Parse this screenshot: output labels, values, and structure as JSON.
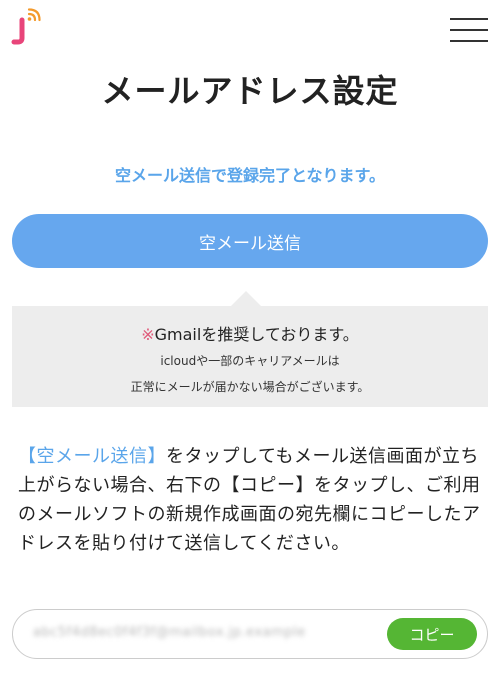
{
  "header": {
    "logo_alt": "J",
    "menu_icon": "hamburger-menu-icon"
  },
  "page": {
    "title": "メールアドレス設定",
    "lead": "空メール送信で登録完了となります。"
  },
  "send_button": {
    "label": "空メール送信"
  },
  "notice": {
    "mark": "※",
    "main": "Gmailを推奨しております。",
    "sub1": "icloudや一部のキャリアメールは",
    "sub2": "正常にメールが届かない場合がございます。"
  },
  "instructions": {
    "highlight": "【空メール送信】",
    "body": "をタップしてもメール送信画面が立ち上がらない場合、右下の【コピー】をタップし、ご利用のメールソフトの新規作成画面の宛先欄にコピーしたアドレスを貼り付けて送信してください。"
  },
  "address": {
    "value": "abc5f4d8ec0f4f3f@mailbox.jp.example"
  },
  "copy_button": {
    "label": "コピー"
  },
  "colors": {
    "accent_blue": "#66a7ee",
    "lead_blue": "#5aa5ea",
    "copy_green": "#55b634",
    "logo_pink": "#e8457a",
    "logo_orange": "#f39a2c"
  }
}
